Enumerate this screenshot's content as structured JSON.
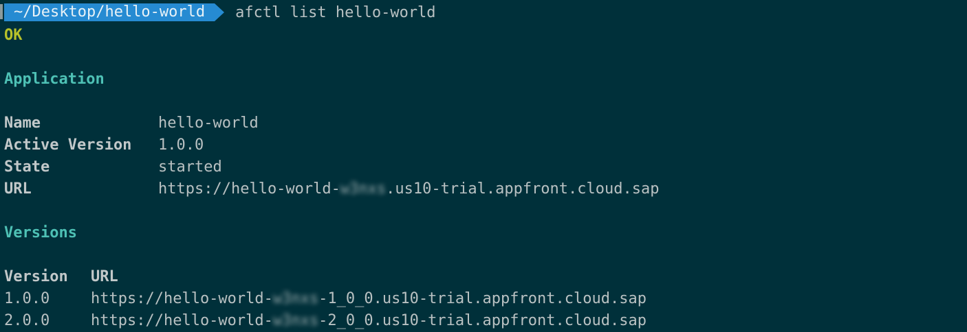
{
  "prompt": {
    "path": "~/Desktop/hello-world",
    "command": "afctl list hello-world"
  },
  "status": "OK",
  "application": {
    "heading": "Application",
    "rows": [
      {
        "label": "Name",
        "value": "hello-world"
      },
      {
        "label": "Active Version",
        "value": "1.0.0"
      },
      {
        "label": "State",
        "value": "started"
      }
    ],
    "url": {
      "label": "URL",
      "prefix": "https://hello-world-",
      "redacted": "w3nxs",
      "suffix": ".us10-trial.appfront.cloud.sap"
    }
  },
  "versions": {
    "heading": "Versions",
    "columns": [
      "Version",
      "URL"
    ],
    "rows": [
      {
        "version": "1.0.0",
        "prefix": "https://hello-world-",
        "redacted": "w3nxs",
        "suffix": "-1_0_0.us10-trial.appfront.cloud.sap"
      },
      {
        "version": "2.0.0",
        "prefix": "https://hello-world-",
        "redacted": "w3nxs",
        "suffix": "-2_0_0.us10-trial.appfront.cloud.sap"
      }
    ]
  },
  "colors": {
    "background": "#00303a",
    "prompt_segment": "#268bd2",
    "ok": "#b7c22a",
    "section_heading": "#4ec1b5"
  }
}
